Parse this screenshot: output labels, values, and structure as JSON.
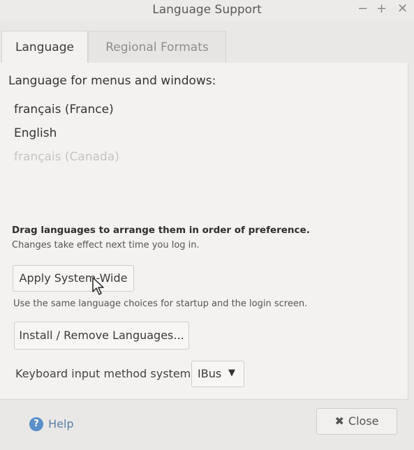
{
  "window": {
    "title": "Language Support",
    "controls": {
      "minimize": "−",
      "maximize": "+",
      "close": "✕"
    }
  },
  "tabs": [
    {
      "label": "Language",
      "selected": true
    },
    {
      "label": "Regional Formats",
      "selected": false
    }
  ],
  "language_section": {
    "label": "Language for menus and windows:",
    "items": [
      {
        "label": "français (France)",
        "enabled": true
      },
      {
        "label": "English",
        "enabled": true
      },
      {
        "label": "français (Canada)",
        "enabled": false
      }
    ],
    "drag_hint": "Drag languages to arrange them in order of preference.",
    "changes_hint": "Changes take effect next time you log in."
  },
  "apply": {
    "button_label": "Apply System-Wide",
    "hint": "Use the same language choices for startup and the login screen."
  },
  "install": {
    "button_label": "Install / Remove Languages..."
  },
  "keyboard": {
    "label": "Keyboard input method system:",
    "selected": "IBus",
    "arrow_icon": "dropdown-arrow-icon"
  },
  "footer": {
    "help_label": "Help",
    "help_icon": "?",
    "close_label": "Close",
    "close_icon": "✖"
  },
  "colors": {
    "window_bg": "#e9e8e6",
    "panel_bg": "#f3f2f0",
    "help_blue": "#5a8fc9"
  }
}
